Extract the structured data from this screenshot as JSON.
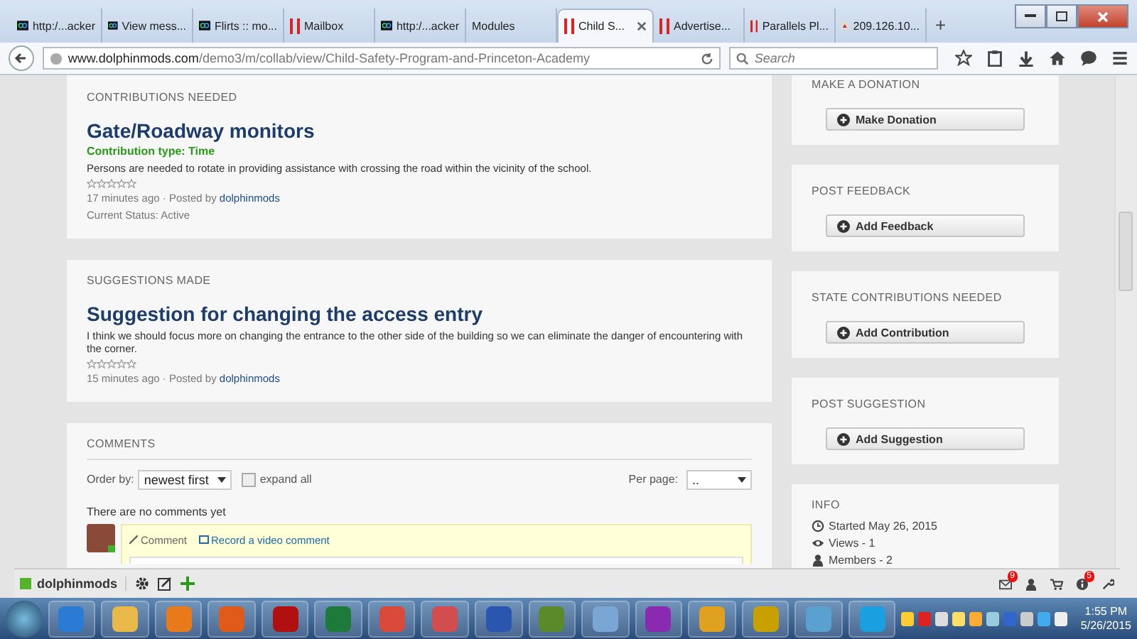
{
  "browser": {
    "tabs": [
      {
        "label": "http:/...acker",
        "kind": "loop",
        "selected": false
      },
      {
        "label": "View mess...",
        "kind": "loop",
        "selected": false
      },
      {
        "label": "Flirts :: mo...",
        "kind": "loop",
        "selected": false
      },
      {
        "label": "Mailbox",
        "kind": "bars",
        "selected": false
      },
      {
        "label": "http:/...acker",
        "kind": "loop",
        "selected": false
      },
      {
        "label": "Modules",
        "kind": "plain",
        "selected": false
      },
      {
        "label": "Child S...",
        "kind": "bars",
        "selected": true
      },
      {
        "label": "Advertise...",
        "kind": "bars",
        "selected": false
      },
      {
        "label": "Parallels Pl...",
        "kind": "bars",
        "selected": false
      },
      {
        "label": "209.126.10...",
        "kind": "page",
        "selected": false
      }
    ],
    "new_tab": "+",
    "url": {
      "domain": "www.dolphinmods.com",
      "path": "/demo3/m/collab/view/Child-Safety-Program-and-Princeton-Academy"
    },
    "search": {
      "placeholder": "Search"
    }
  },
  "main": {
    "contributions": {
      "heading": "CONTRIBUTIONS NEEDED",
      "title": "Gate/Roadway monitors",
      "type": "Contribution type: Time",
      "description": "Persons are needed to rotate in providing assistance with crossing the road within the vicinity of the school.",
      "stars": 0,
      "time": "17 minutes ago",
      "posted_by": "· Posted by",
      "author": "dolphinmods",
      "status": "Current Status: Active"
    },
    "suggestions": {
      "heading": "SUGGESTIONS MADE",
      "title": "Suggestion for changing the access entry",
      "description": "I think we should focus more on changing the entrance to the other side of the building so we can eliminate the danger of encountering with the corner.",
      "stars": 0,
      "time": "15 minutes ago",
      "posted_by": "· Posted by",
      "author": "dolphinmods"
    },
    "comments": {
      "heading": "COMMENTS",
      "order_label": "Order by:",
      "order_value": "newest first",
      "expand_all": {
        "label": "expand all",
        "checked": false
      },
      "per_page_label": "Per page:",
      "per_page_value": "..",
      "empty": "There are no comments yet",
      "author_online": true,
      "actions": [
        {
          "kind": "comment",
          "label": "Comment"
        },
        {
          "kind": "video",
          "label": "Record a video comment"
        }
      ]
    }
  },
  "sidebar": [
    {
      "heading": "MAKE A DONATION",
      "button": "Make Donation"
    },
    {
      "heading": "POST FEEDBACK",
      "button": "Add Feedback"
    },
    {
      "heading": "STATE CONTRIBUTIONS NEEDED",
      "button": "Add Contribution"
    },
    {
      "heading": "POST SUGGESTION",
      "button": "Add Suggestion"
    }
  ],
  "info": {
    "heading": "INFO",
    "lines": [
      {
        "kind": "clock",
        "text": "Started May 26, 2015"
      },
      {
        "kind": "eye",
        "text": "Views - 1"
      },
      {
        "kind": "person",
        "text": "Members - 2"
      }
    ]
  },
  "toolbar": {
    "user": "dolphinmods",
    "right": [
      {
        "kind": "mail",
        "badge": "9"
      },
      {
        "kind": "person"
      },
      {
        "kind": "cart"
      },
      {
        "kind": "info",
        "badge": "5"
      },
      {
        "kind": "wrench"
      }
    ]
  },
  "taskbar": {
    "time": "1:55 PM",
    "date": "5/26/2015"
  }
}
